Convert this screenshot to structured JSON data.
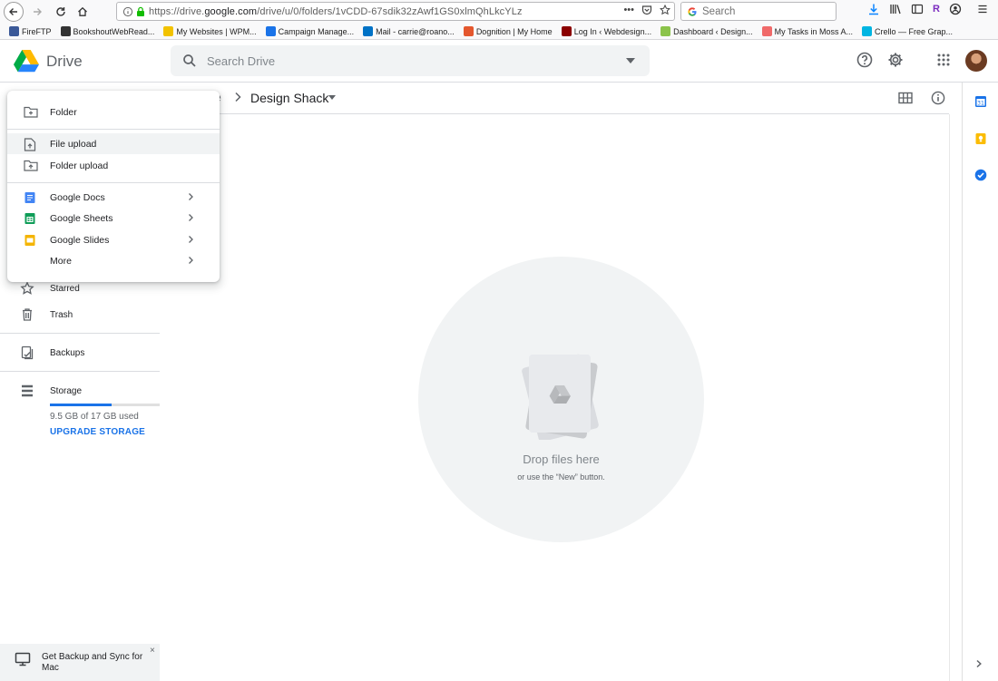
{
  "browser": {
    "url_prefix": "https://drive.",
    "url_domain": "google.com",
    "url_path": "/drive/u/0/folders/1vCDD-67sdik32zAwf1GS0xlmQhLkcYLz",
    "url_more": "•••",
    "search_placeholder": "Search",
    "profile_letter": "R"
  },
  "bookmarks": [
    {
      "label": "FireFTP",
      "color": "#3b5998"
    },
    {
      "label": "BookshoutWebRead...",
      "color": "#333333"
    },
    {
      "label": "My Websites | WPM...",
      "color": "#f2c200"
    },
    {
      "label": "Campaign Manage...",
      "color": "#1a73e8"
    },
    {
      "label": "Mail - carrie@roano...",
      "color": "#0072c6"
    },
    {
      "label": "Dognition | My Home",
      "color": "#e4572e"
    },
    {
      "label": "Log In ‹ Webdesign...",
      "color": "#8b0000"
    },
    {
      "label": "Dashboard ‹ Design...",
      "color": "#8bc34a"
    },
    {
      "label": "My Tasks in Moss A...",
      "color": "#f06a6a"
    },
    {
      "label": "Crello — Free Grap...",
      "color": "#00b5e2"
    }
  ],
  "drive": {
    "logo_text": "Drive",
    "search_placeholder": "Search Drive"
  },
  "breadcrumb": {
    "previous": "e",
    "current": "Design Shack"
  },
  "new_menu": {
    "items": [
      {
        "label": "Folder"
      },
      {
        "label": "File upload"
      },
      {
        "label": "Folder upload"
      },
      {
        "label": "Google Docs"
      },
      {
        "label": "Google Sheets"
      },
      {
        "label": "Google Slides"
      },
      {
        "label": "More"
      }
    ]
  },
  "sidebar": {
    "items": [
      {
        "label": "Starred"
      },
      {
        "label": "Trash"
      },
      {
        "label": "Backups"
      },
      {
        "label": "Storage"
      }
    ],
    "storage_used": "9.5 GB of 17 GB used",
    "storage_fraction": 0.56,
    "upgrade_label": "UPGRADE STORAGE"
  },
  "empty_state": {
    "title": "Drop files here",
    "subtitle": "or use the “New” button."
  },
  "backup_promo": {
    "text": "Get Backup and Sync for Mac",
    "close": "×"
  },
  "colors": {
    "accent": "#1a73e8",
    "docs": "#4285f4",
    "sheets": "#0f9d58",
    "slides": "#f4b400"
  }
}
